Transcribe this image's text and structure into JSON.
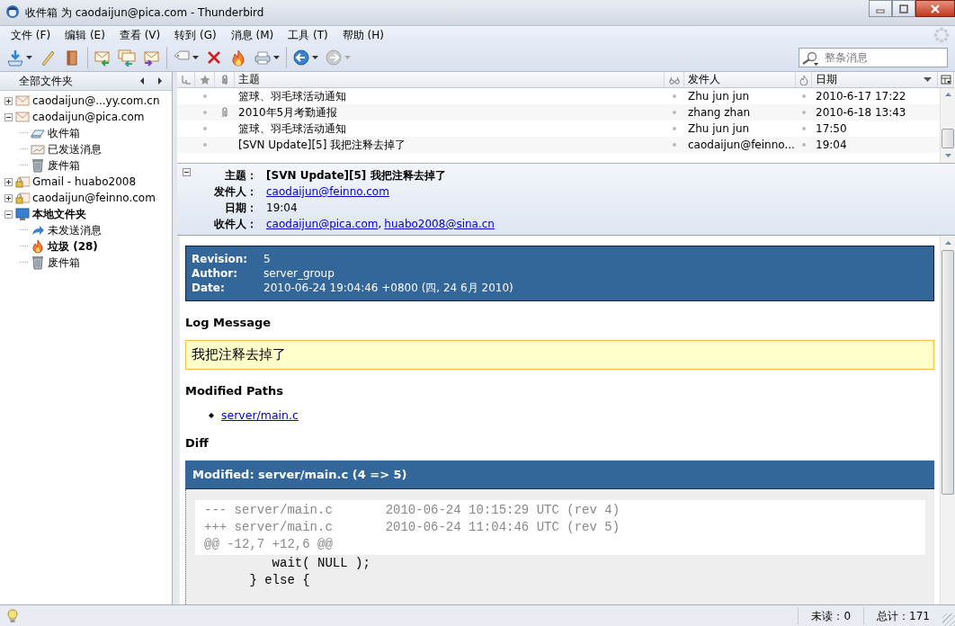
{
  "window": {
    "title": "收件箱 为 caodaijun@pica.com - Thunderbird"
  },
  "menu": [
    {
      "label": "文件 (F)"
    },
    {
      "label": "编辑 (E)"
    },
    {
      "label": "查看 (V)"
    },
    {
      "label": "转到 (G)"
    },
    {
      "label": "消息 (M)"
    },
    {
      "label": "工具 (T)"
    },
    {
      "label": "帮助 (H)"
    }
  ],
  "toolbar": [
    {
      "kind": "get-mail",
      "dropdown": true,
      "disabled": false
    },
    {
      "kind": "write",
      "dropdown": false,
      "disabled": false
    },
    {
      "kind": "address-book",
      "dropdown": false,
      "disabled": false
    },
    {
      "kind": "reply",
      "dropdown": false,
      "disabled": false,
      "group_start": true
    },
    {
      "kind": "reply-all",
      "dropdown": false,
      "disabled": false
    },
    {
      "kind": "forward-mail",
      "dropdown": false,
      "disabled": false
    },
    {
      "kind": "tag",
      "dropdown": true,
      "disabled": false,
      "group_start": true
    },
    {
      "kind": "delete",
      "dropdown": false,
      "disabled": false
    },
    {
      "kind": "junk",
      "dropdown": false,
      "disabled": false
    },
    {
      "kind": "print",
      "dropdown": true,
      "disabled": false
    },
    {
      "kind": "back",
      "dropdown": true,
      "disabled": false,
      "group_start": true
    },
    {
      "kind": "next",
      "dropdown": true,
      "disabled": true
    }
  ],
  "search": {
    "placeholder": "整条消息"
  },
  "sidebar": {
    "title": "全部文件夹",
    "folders": [
      {
        "label": "caodaijun@...yy.com.cn",
        "kind": "account",
        "expanded": false,
        "bold": false
      },
      {
        "label": "caodaijun@pica.com",
        "kind": "account",
        "expanded": true,
        "bold": false,
        "children": [
          {
            "label": "收件箱",
            "kind": "inbox",
            "bold": false
          },
          {
            "label": "已发送消息",
            "kind": "sent",
            "bold": false
          },
          {
            "label": "废件箱",
            "kind": "trash",
            "bold": false
          }
        ]
      },
      {
        "label": "Gmail - huabo2008",
        "kind": "secure-account",
        "expanded": false,
        "bold": false
      },
      {
        "label": "caodaijun@feinno.com",
        "kind": "secure-account",
        "expanded": false,
        "bold": false
      },
      {
        "label": "本地文件夹",
        "kind": "local",
        "expanded": true,
        "bold": true,
        "children": [
          {
            "label": "未发送消息",
            "kind": "outbox",
            "bold": false
          },
          {
            "label": "垃圾 (28)",
            "kind": "junk",
            "bold": true
          },
          {
            "label": "废件箱",
            "kind": "trash",
            "bold": false
          }
        ]
      }
    ]
  },
  "message_list": {
    "columns": [
      {
        "label": "主题",
        "sorted": false
      },
      {
        "label": "发件人",
        "sorted": false
      },
      {
        "label": "日期",
        "sorted": true
      }
    ],
    "rows": [
      {
        "subject": "篮球、羽毛球活动通知",
        "sender": "Zhu jun jun",
        "date": "2010-6-17 17:22",
        "attachment": false
      },
      {
        "subject": "2010年5月考勤通报",
        "sender": "zhang zhan",
        "date": "2010-6-18 13:43",
        "attachment": true
      },
      {
        "subject": "篮球、羽毛球活动通知",
        "sender": "Zhu jun jun",
        "date": "17:50",
        "attachment": false
      },
      {
        "subject": "[SVN Update][5]  我把注释去掉了",
        "sender": "caodaijun@feinno....",
        "date": "19:04",
        "attachment": false
      }
    ]
  },
  "header": {
    "expanded": true,
    "fields": [
      {
        "label": "主题：",
        "values": [
          {
            "text": "[SVN Update][5]  我把注释去掉了",
            "link": false
          }
        ],
        "bold": true
      },
      {
        "label": "发件人：",
        "values": [
          {
            "text": "caodaijun@feinno.com",
            "link": true
          }
        ],
        "bold": false
      },
      {
        "label": "日期：",
        "values": [
          {
            "text": "19:04",
            "link": false
          }
        ],
        "bold": false
      },
      {
        "label": "收件人：",
        "values": [
          {
            "text": "caodaijun@pica.com",
            "link": true
          },
          {
            "text": "huabo2008@sina.cn",
            "link": true
          }
        ],
        "separator": ",",
        "bold": false
      }
    ]
  },
  "body": {
    "info": [
      {
        "label": "Revision:",
        "value": "5"
      },
      {
        "label": "Author:",
        "value": "server_group"
      },
      {
        "label": "Date:",
        "value": "2010-06-24 19:04:46 +0800 (四, 24 6月 2010)"
      }
    ],
    "log_heading": "Log Message",
    "log_message": "我把注释去掉了",
    "paths_heading": "Modified Paths",
    "paths": [
      "server/main.c"
    ],
    "diff_heading": "Diff",
    "diff_title": "Modified: server/main.c (4 => 5)",
    "diff_lines": [
      {
        "kind": "meta",
        "text": "--- server/main.c\t2010-06-24 10:15:29 UTC (rev 4)"
      },
      {
        "kind": "meta",
        "text": "+++ server/main.c\t2010-06-24 11:04:46 UTC (rev 5)"
      },
      {
        "kind": "meta",
        "text": "@@ -12,7 +12,6 @@"
      },
      {
        "kind": "context",
        "text": "         wait( NULL );"
      },
      {
        "kind": "context",
        "text": "      } else {"
      }
    ]
  },
  "status_bar": {
    "unread": "未读：0",
    "total": "总计：171"
  }
}
